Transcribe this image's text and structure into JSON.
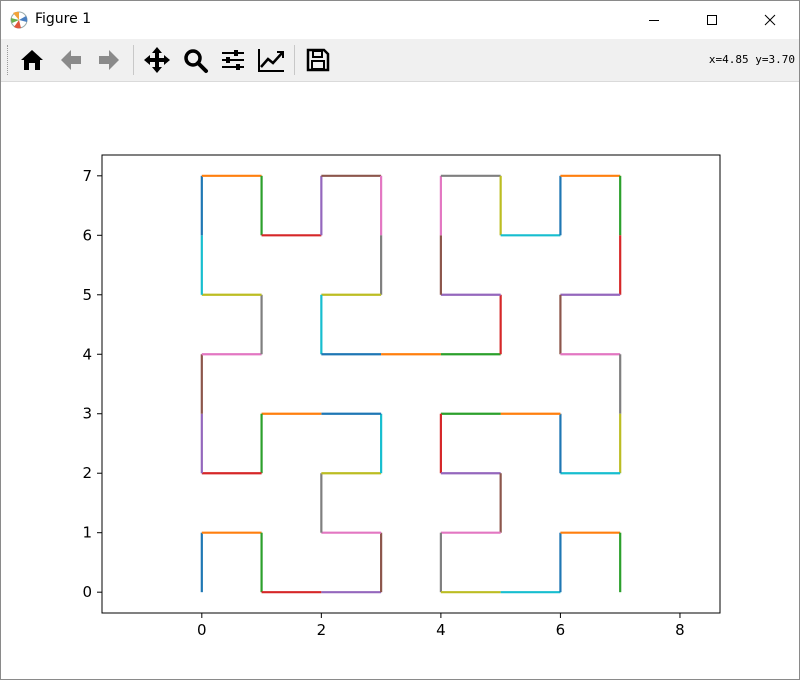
{
  "window": {
    "title": "Figure 1",
    "controls": {
      "minimize": "minimize",
      "maximize": "maximize",
      "close": "close"
    }
  },
  "toolbar": {
    "buttons": [
      {
        "name": "home",
        "icon": "home-icon"
      },
      {
        "name": "back",
        "icon": "arrow-left-icon"
      },
      {
        "name": "forward",
        "icon": "arrow-right-icon"
      },
      {
        "name": "pan",
        "icon": "move-icon"
      },
      {
        "name": "zoom",
        "icon": "magnifier-icon"
      },
      {
        "name": "configure-subplots",
        "icon": "sliders-icon"
      },
      {
        "name": "edit-axis",
        "icon": "line-chart-icon"
      },
      {
        "name": "save",
        "icon": "floppy-disk-icon"
      }
    ],
    "coordinates": "x=4.85 y=3.70"
  },
  "chart_data": {
    "type": "line",
    "title": "",
    "xlabel": "",
    "ylabel": "",
    "xlim": [
      -1.67,
      8.67
    ],
    "ylim": [
      -0.35,
      7.35
    ],
    "xticks": [
      0,
      2,
      4,
      6,
      8
    ],
    "yticks": [
      0,
      1,
      2,
      3,
      4,
      5,
      6,
      7
    ],
    "grid": false,
    "legend": "none",
    "palette": [
      "#1f77b4",
      "#ff7f0e",
      "#2ca02c",
      "#d62728",
      "#9467bd",
      "#8c564b",
      "#e377c2",
      "#7f7f7f",
      "#bcbd22",
      "#17becf"
    ],
    "path": [
      [
        0,
        0
      ],
      [
        0,
        1
      ],
      [
        1,
        1
      ],
      [
        1,
        0
      ],
      [
        2,
        0
      ],
      [
        3,
        0
      ],
      [
        3,
        1
      ],
      [
        2,
        1
      ],
      [
        2,
        2
      ],
      [
        3,
        2
      ],
      [
        3,
        3
      ],
      [
        2,
        3
      ],
      [
        1,
        3
      ],
      [
        1,
        2
      ],
      [
        0,
        2
      ],
      [
        0,
        3
      ],
      [
        0,
        4
      ],
      [
        1,
        4
      ],
      [
        1,
        5
      ],
      [
        0,
        5
      ],
      [
        0,
        6
      ],
      [
        0,
        7
      ],
      [
        1,
        7
      ],
      [
        1,
        6
      ],
      [
        2,
        6
      ],
      [
        2,
        7
      ],
      [
        3,
        7
      ],
      [
        3,
        6
      ],
      [
        3,
        5
      ],
      [
        2,
        5
      ],
      [
        2,
        4
      ],
      [
        3,
        4
      ],
      [
        4,
        4
      ],
      [
        5,
        4
      ],
      [
        5,
        5
      ],
      [
        4,
        5
      ],
      [
        4,
        6
      ],
      [
        4,
        7
      ],
      [
        5,
        7
      ],
      [
        5,
        6
      ],
      [
        6,
        6
      ],
      [
        6,
        7
      ],
      [
        7,
        7
      ],
      [
        7,
        6
      ],
      [
        7,
        5
      ],
      [
        6,
        5
      ],
      [
        6,
        4
      ],
      [
        7,
        4
      ],
      [
        7,
        3
      ],
      [
        7,
        2
      ],
      [
        6,
        2
      ],
      [
        6,
        3
      ],
      [
        5,
        3
      ],
      [
        4,
        3
      ],
      [
        4,
        2
      ],
      [
        5,
        2
      ],
      [
        5,
        1
      ],
      [
        4,
        1
      ],
      [
        4,
        0
      ],
      [
        5,
        0
      ],
      [
        6,
        0
      ],
      [
        6,
        1
      ],
      [
        7,
        1
      ],
      [
        7,
        0
      ]
    ]
  }
}
